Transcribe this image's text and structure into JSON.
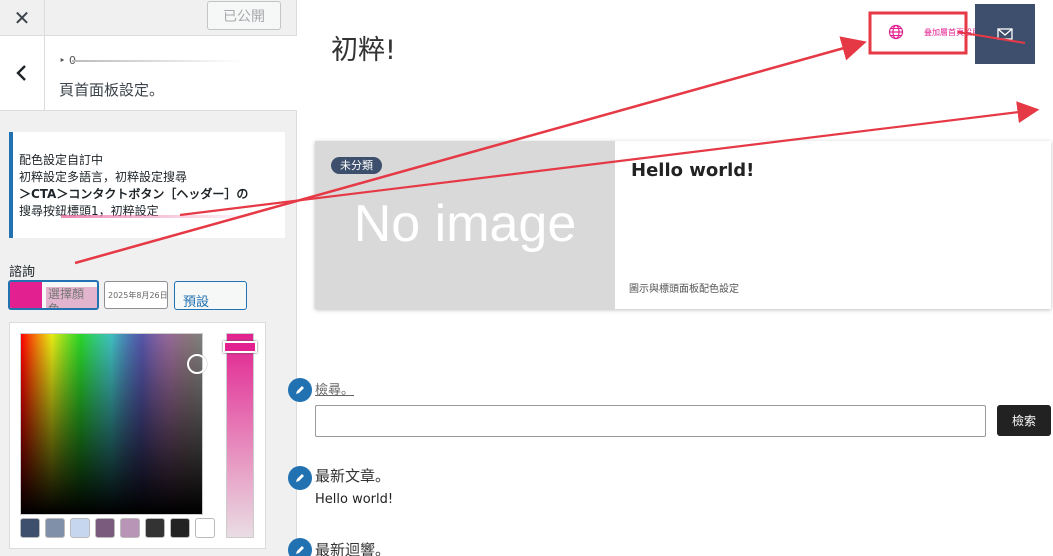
{
  "sidebar": {
    "close_glyph": "✕",
    "published_label": "已公開",
    "breadcrumb": "‣ 0",
    "section_title": "頁首面板設定。",
    "notice": {
      "line1": "配色設定自訂中",
      "line2": "初粹設定多語言，初粹設定搜尋",
      "line3": "＞CTA＞コンタクトボタン［ヘッダー］の",
      "line4": "搜尋按鈕標頭1，初粹設定"
    },
    "color_label": "諮詢",
    "select_color_label": "選擇顏色",
    "hex_value": "2025年8月26日",
    "default_label": "預設",
    "selected_color": "#e2208f",
    "palette": [
      "#3d4f6c",
      "#8090a8",
      "#c7d6ef",
      "#7a5a7d",
      "#b895b6",
      "#333333",
      "#222222",
      "#ffffff"
    ]
  },
  "preview": {
    "site_title": "初粹!",
    "header_cta_text": "叠加層首頁設目時鐘",
    "post": {
      "category": "未分類",
      "no_image": "No image",
      "title": "Hello world!",
      "meta": "圖示與標頭面板配色設定"
    },
    "search": {
      "label": "檢尋。",
      "button": "檢索"
    },
    "recent_posts": {
      "title": "最新文章。",
      "item": "Hello world!"
    },
    "recent_comments": {
      "title": "最新迴響。"
    }
  },
  "colors": {
    "accent": "#e2208f",
    "navy": "#3d4f6c",
    "annotation": "#e63946"
  }
}
